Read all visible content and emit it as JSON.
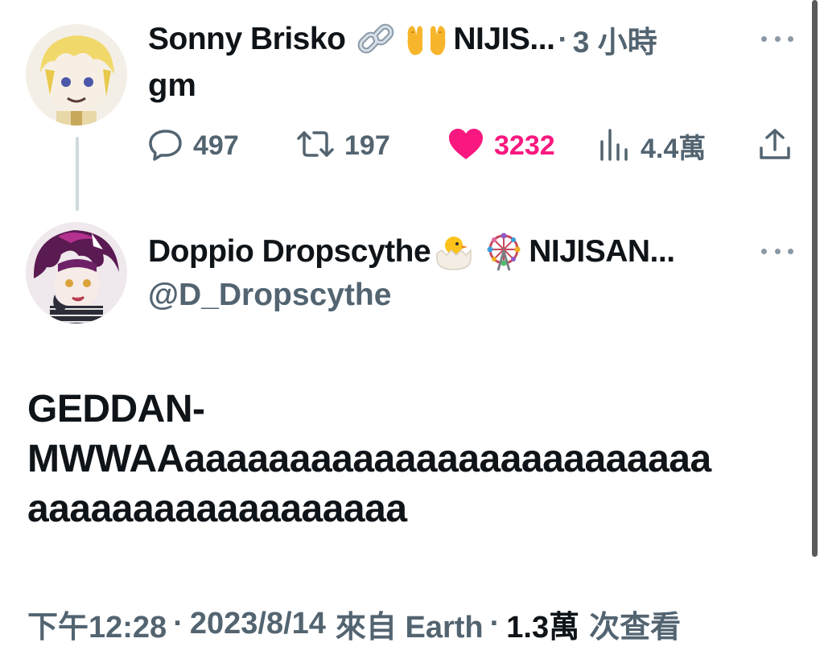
{
  "reply_tweet": {
    "author_name": "Sonny Brisko",
    "badge_emojis": [
      "link-emoji",
      "raising-hands-emoji"
    ],
    "author_suffix": "NIJIS...",
    "separator": "·",
    "time_ago": "3 小時",
    "text": "gm",
    "stats": {
      "replies": "497",
      "retweets": "197",
      "likes": "3232",
      "views": "4.4萬"
    }
  },
  "main_tweet": {
    "author_name": "Doppio Dropscythe",
    "badge_emojis": [
      "hatching-chick-emoji",
      "ferris-wheel-emoji"
    ],
    "author_suffix": "NIJISAN...",
    "handle": "@D_Dropscythe",
    "body_line1": "GEDDAN-",
    "body_line2": "MWWAAaaaaaaaaaaaaaaaaaaaaaaaaa",
    "body_line3": "aaaaaaaaaaaaaaaaaa",
    "footer": {
      "time": "下午12:28",
      "sep1": "·",
      "date": "2023/8/14",
      "source": "來自 Earth",
      "sep2": "·",
      "views_count": "1.3萬",
      "views_label": "次查看"
    }
  },
  "colors": {
    "text": "#0f1419",
    "secondary": "#536471",
    "like": "#f91880",
    "thread_line": "#cfd9de"
  }
}
